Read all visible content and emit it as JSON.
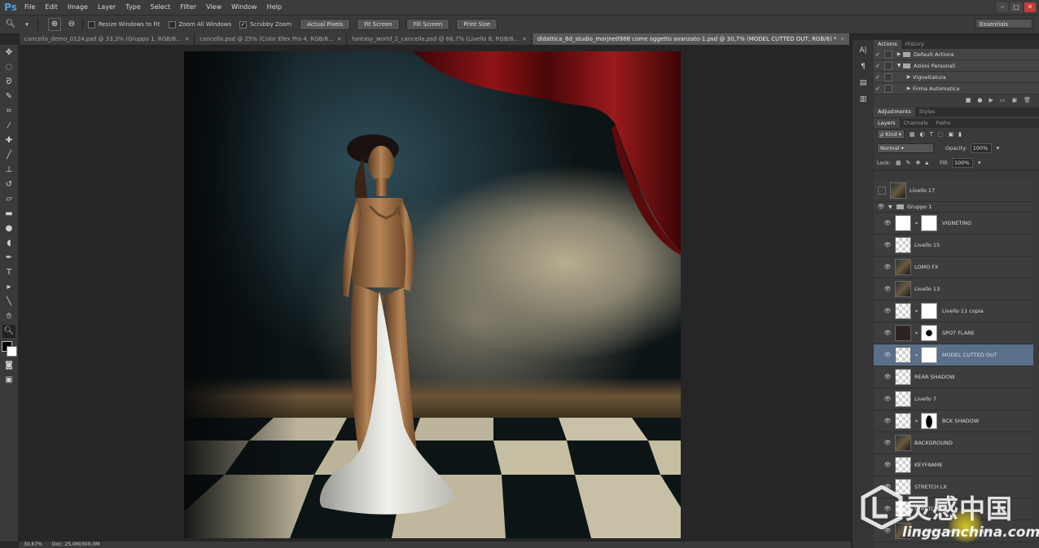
{
  "app": {
    "logo": "Ps",
    "menus": [
      "File",
      "Edit",
      "Image",
      "Layer",
      "Type",
      "Select",
      "Filter",
      "View",
      "Window",
      "Help"
    ]
  },
  "options_bar": {
    "checkboxes": [
      {
        "label": "Resize Windows to Fit",
        "checked": false
      },
      {
        "label": "Zoom All Windows",
        "checked": false
      },
      {
        "label": "Scrubby Zoom",
        "checked": true
      }
    ],
    "buttons": [
      "Actual Pixels",
      "Fit Screen",
      "Fill Screen",
      "Print Size"
    ],
    "workspace": "Essentials"
  },
  "tabs": [
    {
      "label": "cancella_demo_0124.psd @ 33,3% (Gruppo 1, RGB/8...",
      "active": false
    },
    {
      "label": "cancella.psd @ 25% (Color Efex Pro 4, RGB/8...",
      "active": false
    },
    {
      "label": "fantasy_world_2_cancella.psd @ 66,7% (Livello 8, RGB/8...",
      "active": false
    },
    {
      "label": "didattica_6d_studio_morjne0988 come oggetto avanzato-1.psd @ 30,7% (MODEL CUTTED OUT, RGB/8) *",
      "active": true
    }
  ],
  "status": {
    "zoom": "30,67%",
    "doc": "Doc: 25,0M/300,0M"
  },
  "actions_panel": {
    "tabs": [
      "Actions",
      "History"
    ],
    "rows": [
      {
        "label": "Default Actions",
        "type": "set"
      },
      {
        "label": "Azioni Personali",
        "type": "set-open"
      },
      {
        "label": "Vignettatura",
        "type": "action"
      },
      {
        "label": "Firma Automatica",
        "type": "action"
      }
    ]
  },
  "adjustments_panel": {
    "tabs": [
      "Adjustments",
      "Styles"
    ]
  },
  "layers_panel": {
    "tabs": [
      "Layers",
      "Channels",
      "Paths"
    ],
    "filter_kind": "Kind",
    "blend_mode": "Normal",
    "opacity_label": "Opacity:",
    "opacity": "100%",
    "lock_label": "Lock:",
    "fill_label": "Fill:",
    "fill": "100%",
    "layers": [
      {
        "name": "Livello 17",
        "thumb": "photo",
        "mask": false,
        "visible": false,
        "selected": false
      },
      {
        "name": "Gruppo 1",
        "group": true,
        "visible": true
      },
      {
        "name": "VIGNETING",
        "thumb": "white",
        "mask": "plain",
        "visible": true,
        "selected": false
      },
      {
        "name": "Livello 15",
        "thumb": "transparent",
        "mask": false,
        "visible": true,
        "selected": false
      },
      {
        "name": "LOMO FX",
        "thumb": "photo",
        "mask": false,
        "visible": true,
        "selected": false
      },
      {
        "name": "Livello 13",
        "thumb": "photo",
        "mask": false,
        "visible": true,
        "selected": false
      },
      {
        "name": "Livello 11 copia",
        "thumb": "transparent",
        "mask": "plain",
        "visible": true,
        "selected": false
      },
      {
        "name": "SPOT FLARE",
        "thumb": "dark",
        "mask": "spot",
        "visible": true,
        "selected": false
      },
      {
        "name": "MODEL CUTTED OUT",
        "thumb": "transparent",
        "mask": "plain",
        "visible": true,
        "selected": true
      },
      {
        "name": "REAR SHADOW",
        "thumb": "transparent",
        "mask": false,
        "visible": true,
        "selected": false
      },
      {
        "name": "Livello 7",
        "thumb": "transparent",
        "mask": false,
        "visible": true,
        "selected": false
      },
      {
        "name": "BCK SHADOW",
        "thumb": "transparent",
        "mask": "shadow",
        "visible": true,
        "selected": false
      },
      {
        "name": "BACKGROUND",
        "thumb": "photo",
        "mask": false,
        "visible": true,
        "selected": false
      },
      {
        "name": "KEYFRAME",
        "thumb": "transparent",
        "mask": false,
        "visible": true,
        "selected": false
      },
      {
        "name": "STRETCH LX",
        "thumb": "transparent",
        "mask": false,
        "visible": true,
        "selected": false
      },
      {
        "name": "STRETCH DX",
        "thumb": "transparent",
        "mask": false,
        "visible": true,
        "selected": false
      },
      {
        "name": "6d_studio_morjne0988 copia",
        "thumb": "photo",
        "mask": false,
        "visible": true,
        "selected": false
      }
    ]
  },
  "watermark": {
    "text": "灵感中国",
    "url": "lingganchina.com"
  },
  "colors": {
    "selection": "#5a6f8a",
    "ps_blue": "#4aa3df",
    "curtain": "#7a0f12"
  },
  "icons": {
    "tools": [
      "move-icon",
      "marquee-icon",
      "lasso-icon",
      "quick-select-icon",
      "crop-icon",
      "eyedropper-icon",
      "healing-icon",
      "brush-icon",
      "stamp-icon",
      "history-brush-icon",
      "eraser-icon",
      "gradient-icon",
      "blur-icon",
      "dodge-icon",
      "pen-icon",
      "type-icon",
      "path-select-icon",
      "shape-icon",
      "hand-icon",
      "zoom-icon"
    ]
  }
}
